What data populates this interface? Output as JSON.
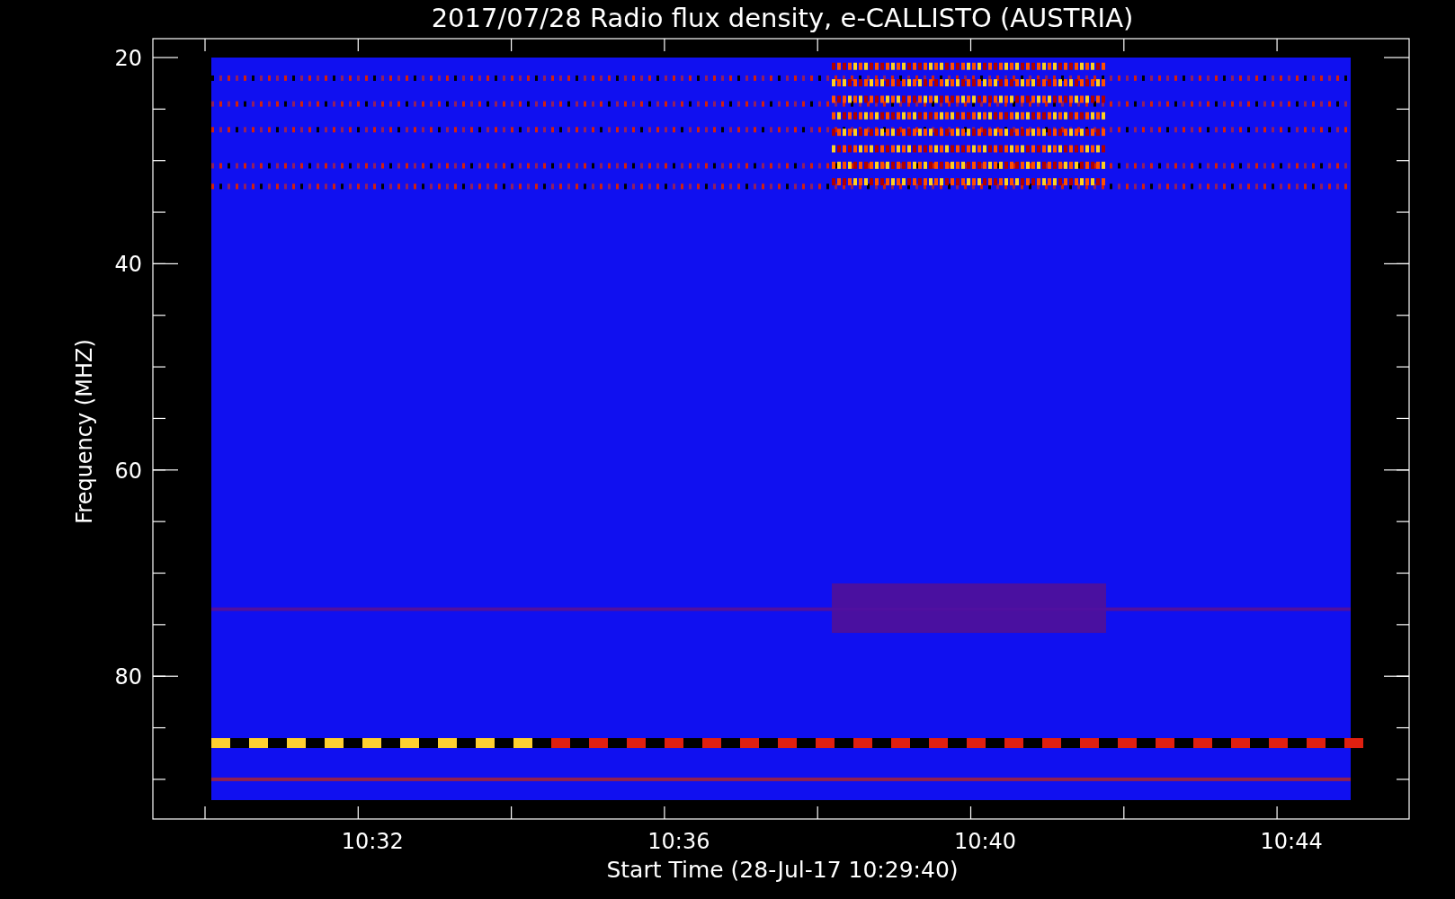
{
  "title": "2017/07/28  Radio flux density, e-CALLISTO (AUSTRIA)",
  "y_axis": {
    "label": "Frequency (MHZ)",
    "ticks": [
      "20",
      "40",
      "60",
      "80"
    ]
  },
  "x_axis": {
    "label": "Start Time (28-Jul-17 10:29:40)",
    "ticks": [
      "10:32",
      "10:36",
      "10:40",
      "10:44"
    ]
  }
}
